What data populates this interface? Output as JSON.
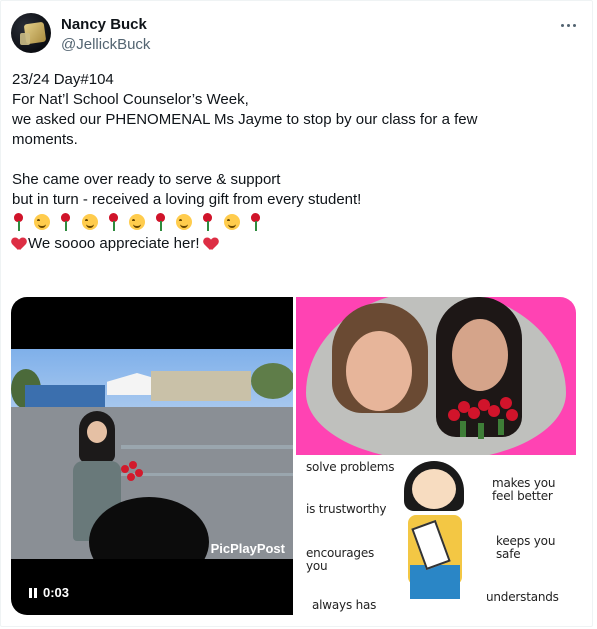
{
  "author": {
    "name": "Nancy Buck",
    "handle": "@JellickBuck"
  },
  "tweet": {
    "lines": [
      "23/24 Day#104",
      "For Nat’l School Counselor’s Week,",
      "we asked our PHENOMENAL Ms Jayme to stop by our class for a few",
      "moments.",
      "She came over ready to serve & support",
      "but in turn - received a loving gift from every student!"
    ],
    "emoji_row": [
      "rose",
      "smile",
      "rose",
      "smile",
      "rose",
      "smile",
      "rose",
      "smile",
      "rose",
      "smile",
      "rose"
    ],
    "closing": "We soooo appreciate her!"
  },
  "media": {
    "video": {
      "watermark": "PicPlayPost",
      "time": "0:03"
    },
    "image_poster": {
      "items": [
        "solve problems",
        "is trustworthy",
        "encourages you",
        "always has",
        "makes you feel better",
        "keeps you safe",
        "understands"
      ]
    }
  },
  "icons": [
    "more-icon",
    "pause-icon",
    "rose-emoji",
    "smile-emoji",
    "heart-emoji"
  ]
}
